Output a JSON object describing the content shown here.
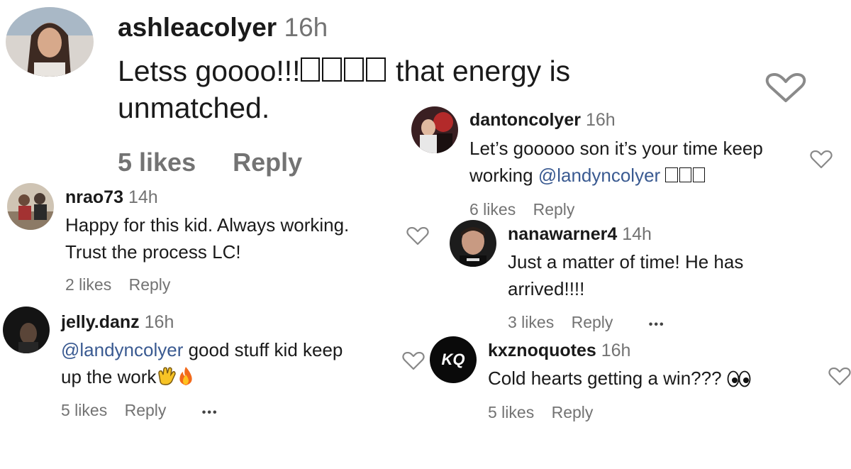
{
  "colors": {
    "username": "#1a1a1a",
    "timestamp": "#737373",
    "mention": "#3a5a91",
    "heart_outline": "#888888"
  },
  "comments": [
    {
      "username": "ashleacolyer",
      "time": "16h",
      "text_line1": "Letss goooo!!!",
      "text_line1b": "that energy is",
      "text_line2": "unmatched.",
      "likes": "5 likes",
      "reply": "Reply"
    },
    {
      "username": "dantoncolyer",
      "time": "16h",
      "text_line1": "Let’s gooooo son it’s your time keep",
      "text_line2_prefix": "working ",
      "mention": "@landyncolyer",
      "likes": "6 likes",
      "reply": "Reply"
    },
    {
      "username": "nrao73",
      "time": "14h",
      "text_line1": "Happy for this kid. Always working.",
      "text_line2": "Trust the process LC!",
      "likes": "2 likes",
      "reply": "Reply"
    },
    {
      "username": "nanawarner4",
      "time": "14h",
      "text_line1": "Just a matter of time! He has",
      "text_line2": "arrived!!!!",
      "likes": "3 likes",
      "reply": "Reply",
      "more": "•••"
    },
    {
      "username": "jelly.danz",
      "time": "16h",
      "mention": "@landyncolyer",
      "text_line1_suffix": " good stuff kid keep",
      "text_line2": "up the work",
      "likes": "5 likes",
      "reply": "Reply",
      "more": "•••"
    },
    {
      "username": "kxznoquotes",
      "time": "16h",
      "text_line1": "Cold hearts getting a win???",
      "likes": "5 likes",
      "reply": "Reply",
      "avatar_text": "KQ"
    }
  ],
  "icons": {
    "like": "heart-outline-icon",
    "clap": "clapping-hands-emoji",
    "fire": "fire-emoji",
    "eyes": "eyes-emoji"
  }
}
